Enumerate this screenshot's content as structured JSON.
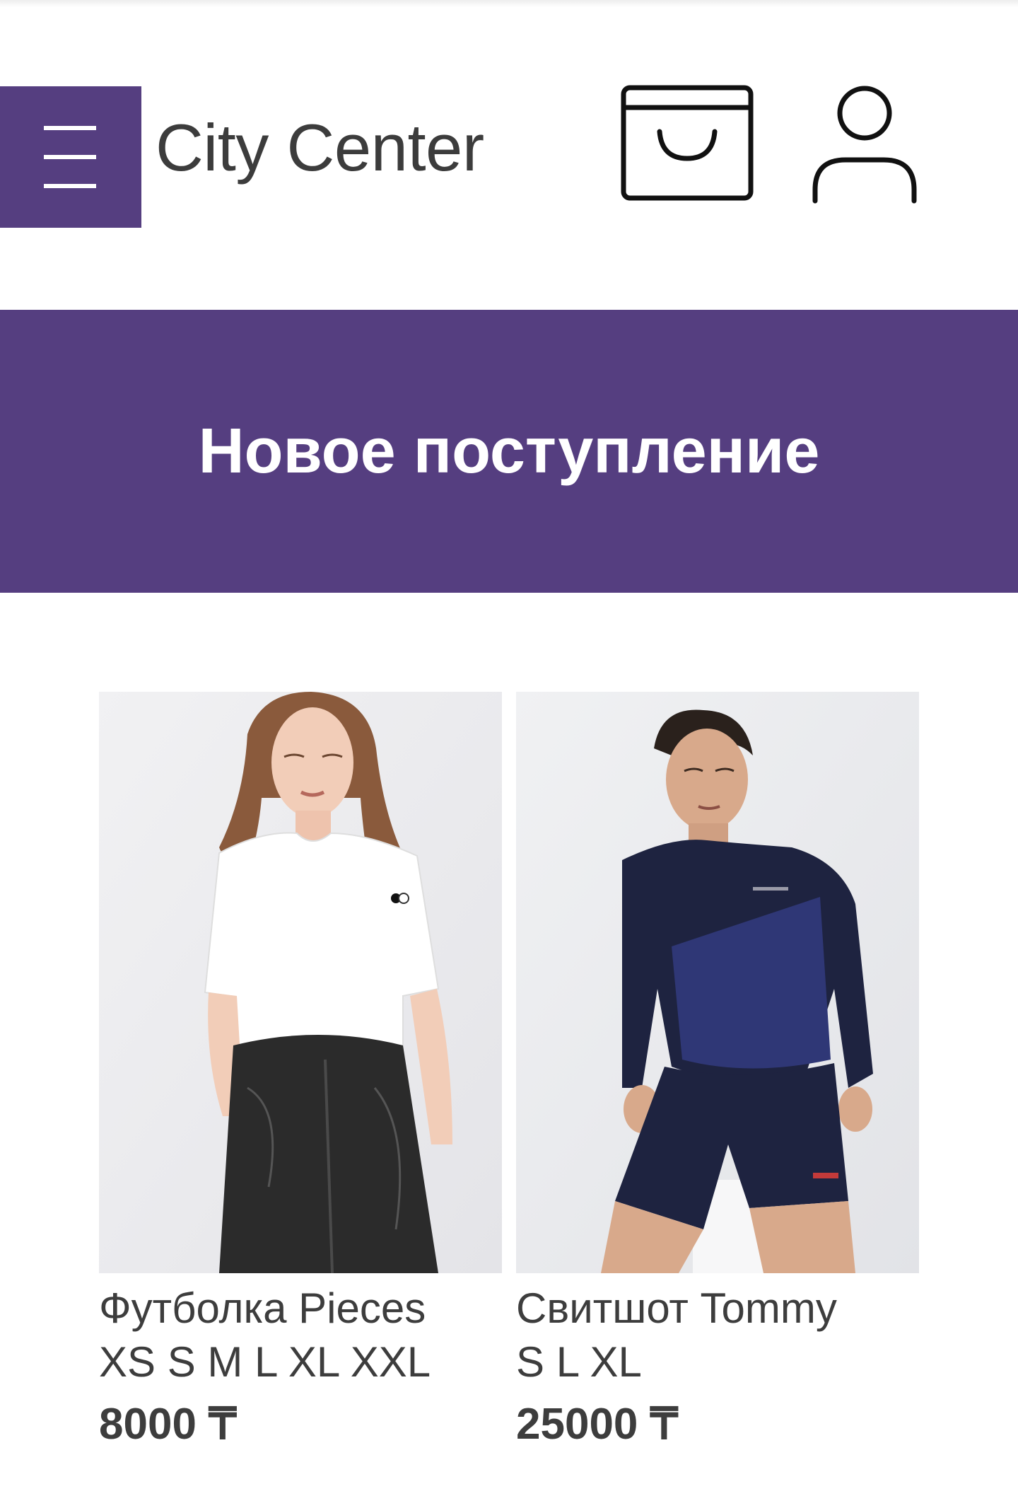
{
  "header": {
    "brand": "City Center",
    "menu_icon": "hamburger-menu-icon",
    "cart_icon": "shopping-bag-icon",
    "user_icon": "user-profile-icon"
  },
  "banner": {
    "title": "Новое поступление"
  },
  "products": [
    {
      "name": "Футболка Pieces",
      "sizes": "XS S M L XL XXL",
      "price": "8000 ₸",
      "image": "woman in white t-shirt and black leather trousers"
    },
    {
      "name": "Свитшот Tommy",
      "sizes": "S L XL",
      "price": "25000 ₸",
      "image": "man in navy sweatshirt and navy shorts"
    }
  ],
  "colors": {
    "accent": "#553e80",
    "text": "#3d3d3d",
    "background": "#ffffff"
  }
}
